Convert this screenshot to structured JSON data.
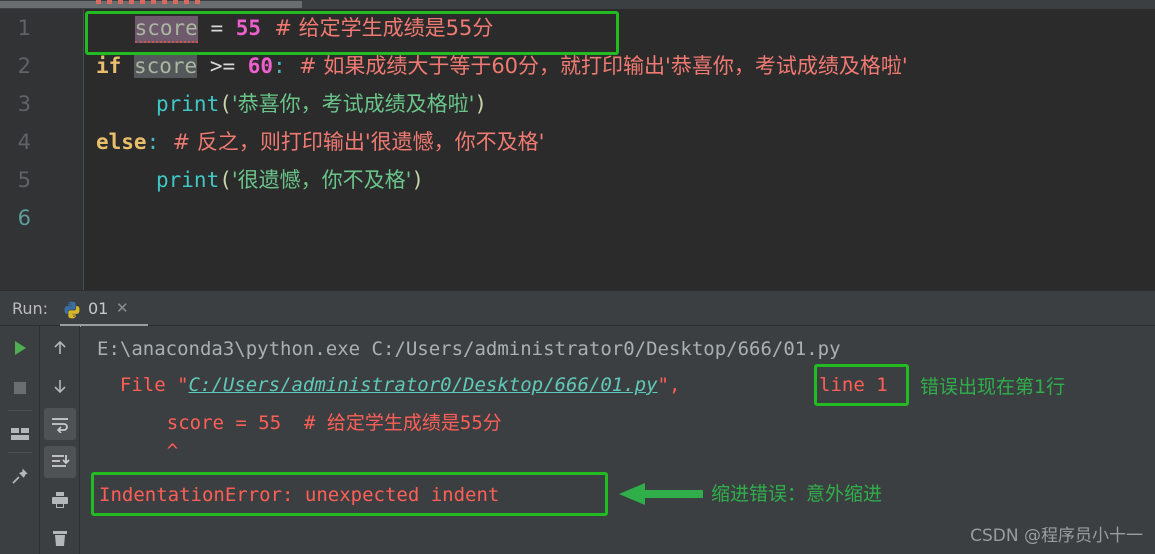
{
  "editor": {
    "line_numbers": [
      "1",
      "2",
      "3",
      "4",
      "5",
      "6"
    ],
    "current_line": "6",
    "lines": [
      {
        "n": "1",
        "indent": "    ",
        "ident": "score",
        "op": " = ",
        "num": "55",
        "comment": "  # 给定学生成绩是55分"
      },
      {
        "n": "2",
        "kw": "if",
        "ident": "score",
        "op": " >= ",
        "num": "60",
        "punct": ":",
        "comment": "  # 如果成绩大于等于60分，就打印输出'恭喜你，考试成绩及格啦'"
      },
      {
        "n": "3",
        "fn": "print",
        "open": "(",
        "str": "'恭喜你，考试成绩及格啦'",
        "close": ")"
      },
      {
        "n": "4",
        "kw": "else",
        "punct": ":",
        "comment": "  # 反之，则打印输出'很遗憾，你不及格'"
      },
      {
        "n": "5",
        "fn": "print",
        "open": "(",
        "str": "'很遗憾，你不及格'",
        "close": ")"
      },
      {
        "n": "6",
        "empty": ""
      }
    ]
  },
  "run_panel": {
    "label": "Run:",
    "tab_name": "01",
    "tab_close": "✕",
    "python_icon": "python-icon"
  },
  "toolbar_left": {
    "items": [
      {
        "name": "rerun-button",
        "icon": "play-icon"
      },
      {
        "name": "stop-button",
        "icon": "stop-square-icon"
      },
      {
        "name": "layout-button",
        "icon": "layout-icon"
      },
      {
        "name": "pin-tab-button",
        "icon": "pin-icon"
      }
    ]
  },
  "toolbar_left2": {
    "items": [
      {
        "name": "up-stack-trace-button",
        "icon": "arrow-up-icon"
      },
      {
        "name": "down-stack-trace-button",
        "icon": "arrow-down-icon"
      },
      {
        "name": "soft-wrap-button",
        "icon": "soft-wrap-icon"
      },
      {
        "name": "scroll-to-end-button",
        "icon": "scroll-to-end-icon"
      },
      {
        "name": "print-button",
        "icon": "printer-icon"
      },
      {
        "name": "clear-all-button",
        "icon": "trash-icon"
      }
    ]
  },
  "console": {
    "cmd": "E:\\anaconda3\\python.exe C:/Users/administrator0/Desktop/666/01.py",
    "file_prefix": "  File \"",
    "file_link": "C:/Users/administrator0/Desktop/666/01.py",
    "file_suffix": "\", ",
    "line_ref": "line 1",
    "err_code": "    score = 55  # 给定学生成绩是55分",
    "caret": "    ^",
    "error": "IndentationError: unexpected indent"
  },
  "annotations": {
    "line_ref_note": "错误出现在第1行",
    "error_note": "缩进错误：意外缩进",
    "arrow": "arrow-left-icon"
  },
  "watermark": "CSDN @程序员小十一",
  "colors": {
    "editor_bg": "#2b2b2b",
    "panel_bg": "#3c3f41",
    "gutter_bg": "#313335",
    "annotation_green": "#22bb22",
    "error_red": "#ff5f56",
    "link_teal": "#5fc9b8"
  }
}
